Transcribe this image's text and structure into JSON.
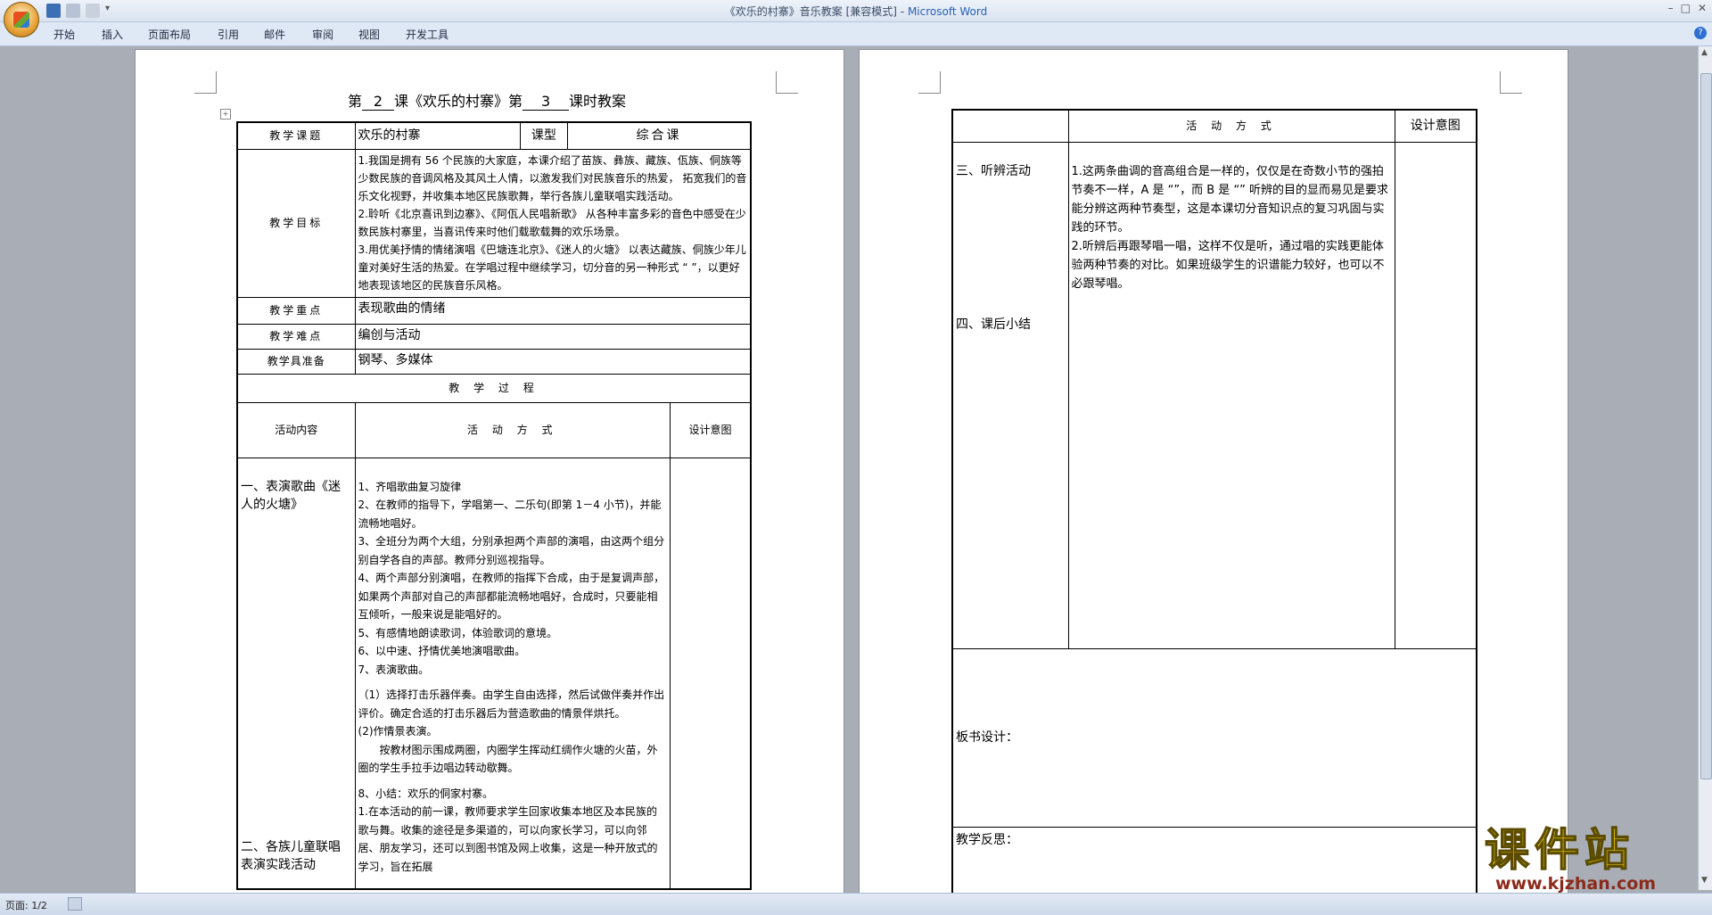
{
  "window": {
    "title_doc": "《欢乐的村寨》音乐教案 [兼容模式]",
    "title_sep": " - ",
    "title_app": "Microsoft Word",
    "controls": [
      "–",
      "□",
      "✕"
    ]
  },
  "ribbon": {
    "tabs": [
      "开始",
      "插入",
      "页面布局",
      "引用",
      "邮件",
      "审阅",
      "视图",
      "开发工具"
    ]
  },
  "doc": {
    "heading": {
      "p1": "第",
      "lesson": "2",
      "p2": "课《欢乐的村寨》第",
      "period": "3",
      "p3": "课时教案"
    },
    "info": {
      "topic_label": "教学课题",
      "topic": "欢乐的村寨",
      "type_label": "课型",
      "type": "综合课",
      "goal_label": "教学目标",
      "goals": [
        "1.我国是拥有 56 个民族的大家庭，本课介绍了苗族、彝族、藏族、佤族、侗族等少数民族的音调风格及其风土人情，以激发我们对民族音乐的热爱，  拓宽我们的音乐文化视野，并收集本地区民族歌舞，举行各族儿童联唱实践活动。",
        "2.聆听《北京喜讯到边寨》、《阿佤人民唱新歌》 从各种丰富多彩的音色中感受在少数民族村寨里，当喜讯传来时他们载歌载舞的欢乐场景。",
        "3.用优美抒情的情绪演唱《巴塘连北京》、《迷人的火塘》 以表达藏族、侗族少年儿童对美好生活的热爱。在学唱过程中继续学习，切分音的另一种形式 “ ”，以更好地表现该地区的民族音乐风格。"
      ],
      "key_label": "教学重点",
      "key": "表现歌曲的情绪",
      "difficulty_label": "教学难点",
      "difficulty": "编创与活动",
      "prep_label": "教学具准备",
      "prep": "钢琴、多媒体",
      "process_label": "教 学 过 程",
      "col_content": "活动内容",
      "col_method": "活 动 方 式",
      "col_design": "设计意图"
    },
    "page1_activities": [
      "一、表演歌曲《迷人的火塘》",
      "二、各族儿童联唱表演实践活动"
    ],
    "page1_methods": [
      "1、齐唱歌曲复习旋律",
      "2、在教师的指导下，学唱第一、二乐句(即第 1－4 小节)，并能流畅地唱好。",
      "3、全班分为两个大组，分别承担两个声部的演唱，由这两个组分别自学各自的声部。教师分别巡视指导。",
      "4、两个声部分别演唱，在教师的指挥下合成，由于是复调声部，如果两个声部对自己的声部都能流畅地唱好，合成时，只要能相互倾听，一般来说是能唱好的。",
      "5、有感情地朗读歌词，体验歌词的意境。",
      "6、以中速、抒情优美地演唱歌曲。",
      "7、表演歌曲。",
      "（1）选择打击乐器伴奏。由学生自由选择，然后试做伴奏并作出评价。确定合适的打击乐器后为营造歌曲的情景伴烘托。",
      "(2)作情景表演。",
      "按教材图示围成两圈，内圈学生挥动红绸作火塘的火苗，外圈的学生手拉手边唱边转动歇舞。",
      "8、小结：欢乐的侗家村寨。",
      "1.在本活动的前一课，教师要求学生回家收集本地区及本民族的歌与舞。收集的途径是多渠道的，可以向家长学习，可以向邻居、朋友学习，还可以到图书馆及网上收集，这是一种开放式的学习，旨在拓展"
    ],
    "page2": {
      "col_method": "活 动 方 式",
      "col_design": "设计意图",
      "activity3": "三、听辨活动",
      "activity4": "四、课后小结",
      "methods": [
        "1.这两条曲调的音高组合是一样的，仅仅是在奇数小节的强拍节奏不一样，A 是 “”，而 B 是 “” 听辨的目的显而易见是要求能分辨这两种节奏型，这是本课切分音知识点的复习巩固与实践的环节。",
        "2.听辨后再跟琴唱一唱，这样不仅是听，通过唱的实践更能体验两种节奏的对比。如果班级学生的识谱能力较好，也可以不必跟琴唱。"
      ],
      "board_label": "板书设计：",
      "reflection_label": "教学反思："
    }
  },
  "status": {
    "page": "页面: 1/2"
  },
  "watermark": {
    "text": "课件站",
    "url": "www.kjzhan.com"
  },
  "colors": {
    "word_blue": "#2a5fb0",
    "wm_yellow": "#f5d400",
    "wm_url": "#8b2a1a"
  }
}
